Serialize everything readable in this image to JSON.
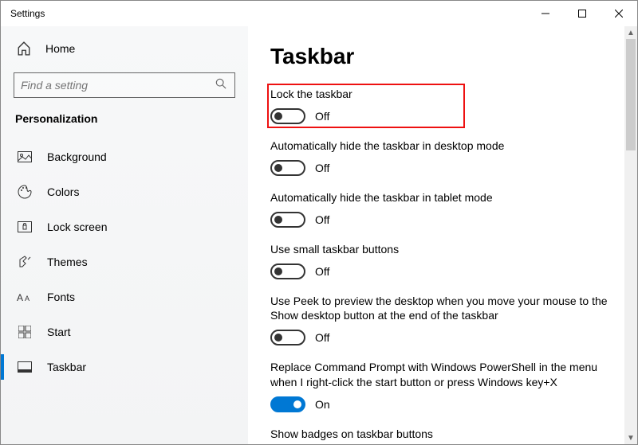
{
  "window": {
    "title": "Settings"
  },
  "sidebar": {
    "home": "Home",
    "search_placeholder": "Find a setting",
    "section": "Personalization",
    "items": [
      {
        "label": "Background"
      },
      {
        "label": "Colors"
      },
      {
        "label": "Lock screen"
      },
      {
        "label": "Themes"
      },
      {
        "label": "Fonts"
      },
      {
        "label": "Start"
      },
      {
        "label": "Taskbar"
      }
    ]
  },
  "main": {
    "heading": "Taskbar",
    "settings": [
      {
        "label": "Lock the taskbar",
        "state": "Off",
        "on": false
      },
      {
        "label": "Automatically hide the taskbar in desktop mode",
        "state": "Off",
        "on": false
      },
      {
        "label": "Automatically hide the taskbar in tablet mode",
        "state": "Off",
        "on": false
      },
      {
        "label": "Use small taskbar buttons",
        "state": "Off",
        "on": false
      },
      {
        "label": "Use Peek to preview the desktop when you move your mouse to the Show desktop button at the end of the taskbar",
        "state": "Off",
        "on": false
      },
      {
        "label": "Replace Command Prompt with Windows PowerShell in the menu when I right-click the start button or press Windows key+X",
        "state": "On",
        "on": true
      },
      {
        "label": "Show badges on taskbar buttons",
        "state": "",
        "on": false
      }
    ]
  }
}
